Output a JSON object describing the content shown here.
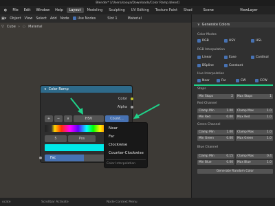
{
  "titlebar": {
    "title": "Blender* [/Users/sooya/Downloads/Color Ramp.blend]"
  },
  "menubar": {
    "items": [
      "File",
      "Edit",
      "Window",
      "Help"
    ],
    "workspaces": [
      "Layout",
      "Modeling",
      "Sculpting",
      "UV Editing",
      "Texture Paint",
      "Shad"
    ],
    "scene": "Scene",
    "viewlayer": "ViewLayer"
  },
  "header": {
    "object": "Object",
    "view": "View",
    "select": "Select",
    "add": "Add",
    "node": "Node",
    "use_nodes": "Use Nodes",
    "slot": "Slot 1",
    "material": "Material"
  },
  "breadcrumb": {
    "object": "Cube",
    "material": "Material"
  },
  "node": {
    "title": "Color Ramp",
    "output_color": "Color",
    "output_alpha": "Alpha",
    "add": "+",
    "remove": "−",
    "menu": "∨",
    "color_mode": "HSV",
    "interpolation": "Count...",
    "stop_index": "5",
    "pos_label": "Pos",
    "fac_label": "Fac",
    "fac_value": 0.47,
    "color_swatch": "#00e8e8"
  },
  "dropdown": {
    "items": [
      "Near",
      "Far",
      "Clockwise",
      "Counter-Clockwise"
    ],
    "title": "Color Interpolation"
  },
  "sidebar": {
    "header": "Generate Colors",
    "color_modes_label": "Color Modes",
    "color_modes": [
      "RGB",
      "HSV",
      "HSL"
    ],
    "rgb_interp_label": "RGB Interpolation",
    "rgb_interp": [
      "Linear",
      "Ease",
      "Cardinal",
      "BSpline",
      "Constant"
    ],
    "hue_interp_label": "Hue Interpolation",
    "hue_interp": [
      "Near",
      "Far",
      "CW",
      "CCW"
    ],
    "stops_label": "Stops",
    "min_stops_label": "Min Stops",
    "min_stops_value": "2",
    "max_stops_label": "Max Stops",
    "max_stops_value": "1",
    "red_channel_label": "Red Channel",
    "green_channel_label": "Green Channel",
    "blue_channel_label": "Blue Channel",
    "clamp_min": "Clamp Min",
    "clamp_max": "Clamp Max",
    "min_red": "Min Red",
    "max_red": "Max Red",
    "min_green": "Min Green",
    "max_green": "Max Green",
    "min_blue": "Min Blue",
    "max_blue": "Max Blue",
    "red": {
      "clamp_min": "1.00",
      "clamp_max": "1.0",
      "min": "0.00",
      "max": "1.0"
    },
    "green": {
      "clamp_min": "1.00",
      "clamp_max": "1.0",
      "min": "0.00",
      "max": "1.0"
    },
    "blue": {
      "clamp_min": "0.15",
      "clamp_max": "0.4",
      "min": "0.00",
      "max": "1.0"
    },
    "generate_button": "Generate Random Color"
  },
  "statusbar": {
    "left": "Scrollbar Activate",
    "middle": "Node Context Menu",
    "leftmost": "ocate"
  },
  "colors": {
    "accent": "#4772b3",
    "arrow": "#1fd38a",
    "node_header": "#2e6a8a"
  }
}
